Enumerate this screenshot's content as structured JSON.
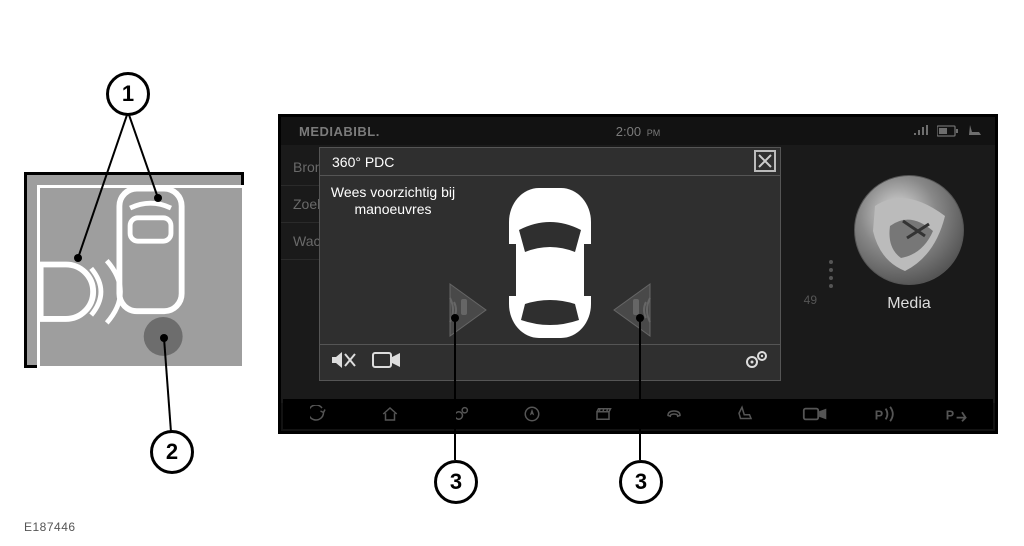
{
  "statusbar": {
    "source_label": "MEDIABIBL.",
    "time": "2:00",
    "ampm": "PM"
  },
  "left_list": {
    "rows": [
      "Bron",
      "Zoek",
      "Wac"
    ]
  },
  "pdc": {
    "title": "360° PDC",
    "message": "Wees voorzichtig bij manoeuvres"
  },
  "media": {
    "label": "Media"
  },
  "misc_text": {
    "right_time_fragment": "49"
  },
  "callouts": {
    "c1": "1",
    "c2": "2",
    "c3a": "3",
    "c3b": "3"
  },
  "figure_ref": "E187446"
}
